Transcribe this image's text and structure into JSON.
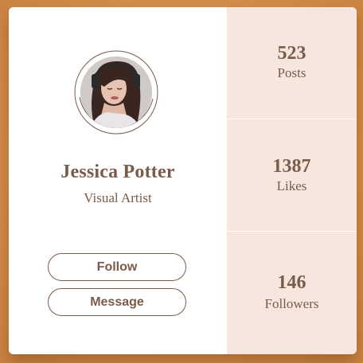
{
  "profile": {
    "name": "Jessica Potter",
    "role": "Visual Artist",
    "avatar": "profile-photo-woman-with-headphones"
  },
  "actions": {
    "follow_label": "Follow",
    "message_label": "Message"
  },
  "stats": [
    {
      "value": "523",
      "label": "Posts"
    },
    {
      "value": "1387",
      "label": "Likes"
    },
    {
      "value": "146",
      "label": "Followers"
    }
  ],
  "colors": {
    "background": "#d8914f",
    "card": "#ffffff",
    "stats_panel": "#f6e6dd",
    "text": "#7a5c4a"
  }
}
